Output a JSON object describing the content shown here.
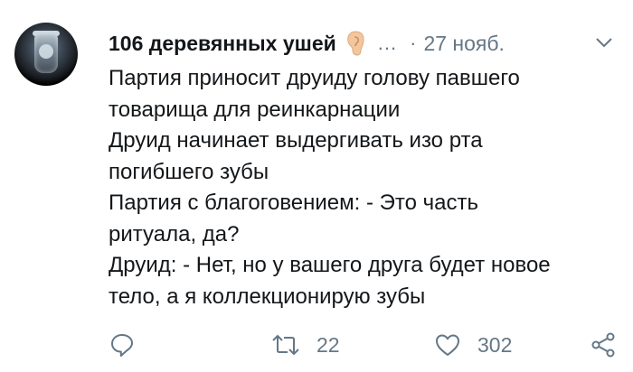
{
  "tweet": {
    "author": {
      "display_name": "106 деревянных ушей",
      "handle": "...",
      "date": "27 нояб."
    },
    "icons": {
      "avatar": "jar-with-head-avatar",
      "name_emoji": "ear-icon",
      "menu": "chevron-down-icon"
    },
    "text_lines": [
      "Партия приносит друиду голову павшего",
      "товарища для реинкарнации",
      "Друид начинает выдергивать изо рта",
      "погибшего зубы",
      "Партия с благоговением: - Это часть",
      "ритуала, да?",
      "Друид: - Нет, но у вашего друга будет новое",
      "тело, а я коллекционирую зубы"
    ],
    "actions": {
      "reply_icon": "reply-icon",
      "retweet_icon": "retweet-icon",
      "retweet_count": "22",
      "like_icon": "heart-icon",
      "like_count": "302",
      "share_icon": "share-icon"
    },
    "colors": {
      "text": "#14171a",
      "secondary": "#657786",
      "ear": "#f2c7a0"
    }
  }
}
